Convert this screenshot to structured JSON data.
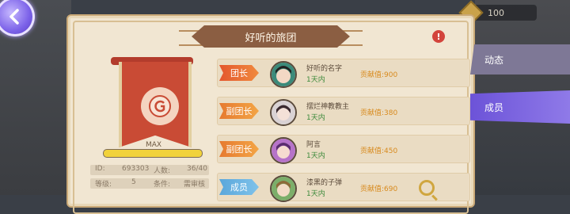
{
  "topbar": {
    "coin_value": "100"
  },
  "guild": {
    "title": "好听的旅团",
    "alert": "!",
    "level_label": "MAX",
    "exp_fraction": 1.0,
    "info": {
      "id_label": "ID:",
      "id_value": "693303",
      "members_label": "人数:",
      "members_value": "36/40",
      "level_label": "等级:",
      "level_value": "5",
      "condition_label": "条件:",
      "condition_value": "需审核"
    }
  },
  "members": [
    {
      "role": "团长",
      "name": "好听的名字",
      "status": "1天内",
      "contribution": "贡献值:900"
    },
    {
      "role": "副团长",
      "name": "摆烂神教教主",
      "status": "1天内",
      "contribution": "贡献值:380"
    },
    {
      "role": "副团长",
      "name": "阿言",
      "status": "1天内",
      "contribution": "贡献值:450"
    },
    {
      "role": "成员",
      "name": "漆黑的子弹",
      "status": "1天内",
      "contribution": "贡献值:690"
    }
  ],
  "tabs": [
    {
      "label": "动态"
    },
    {
      "label": "成员"
    }
  ],
  "colors": {
    "panel_bg": "#f1e6d2",
    "active_tab": "#7a62e0",
    "leader_tag": "#e4572e",
    "member_tag": "#5aa7db",
    "contribution_text": "#d88a1d"
  }
}
